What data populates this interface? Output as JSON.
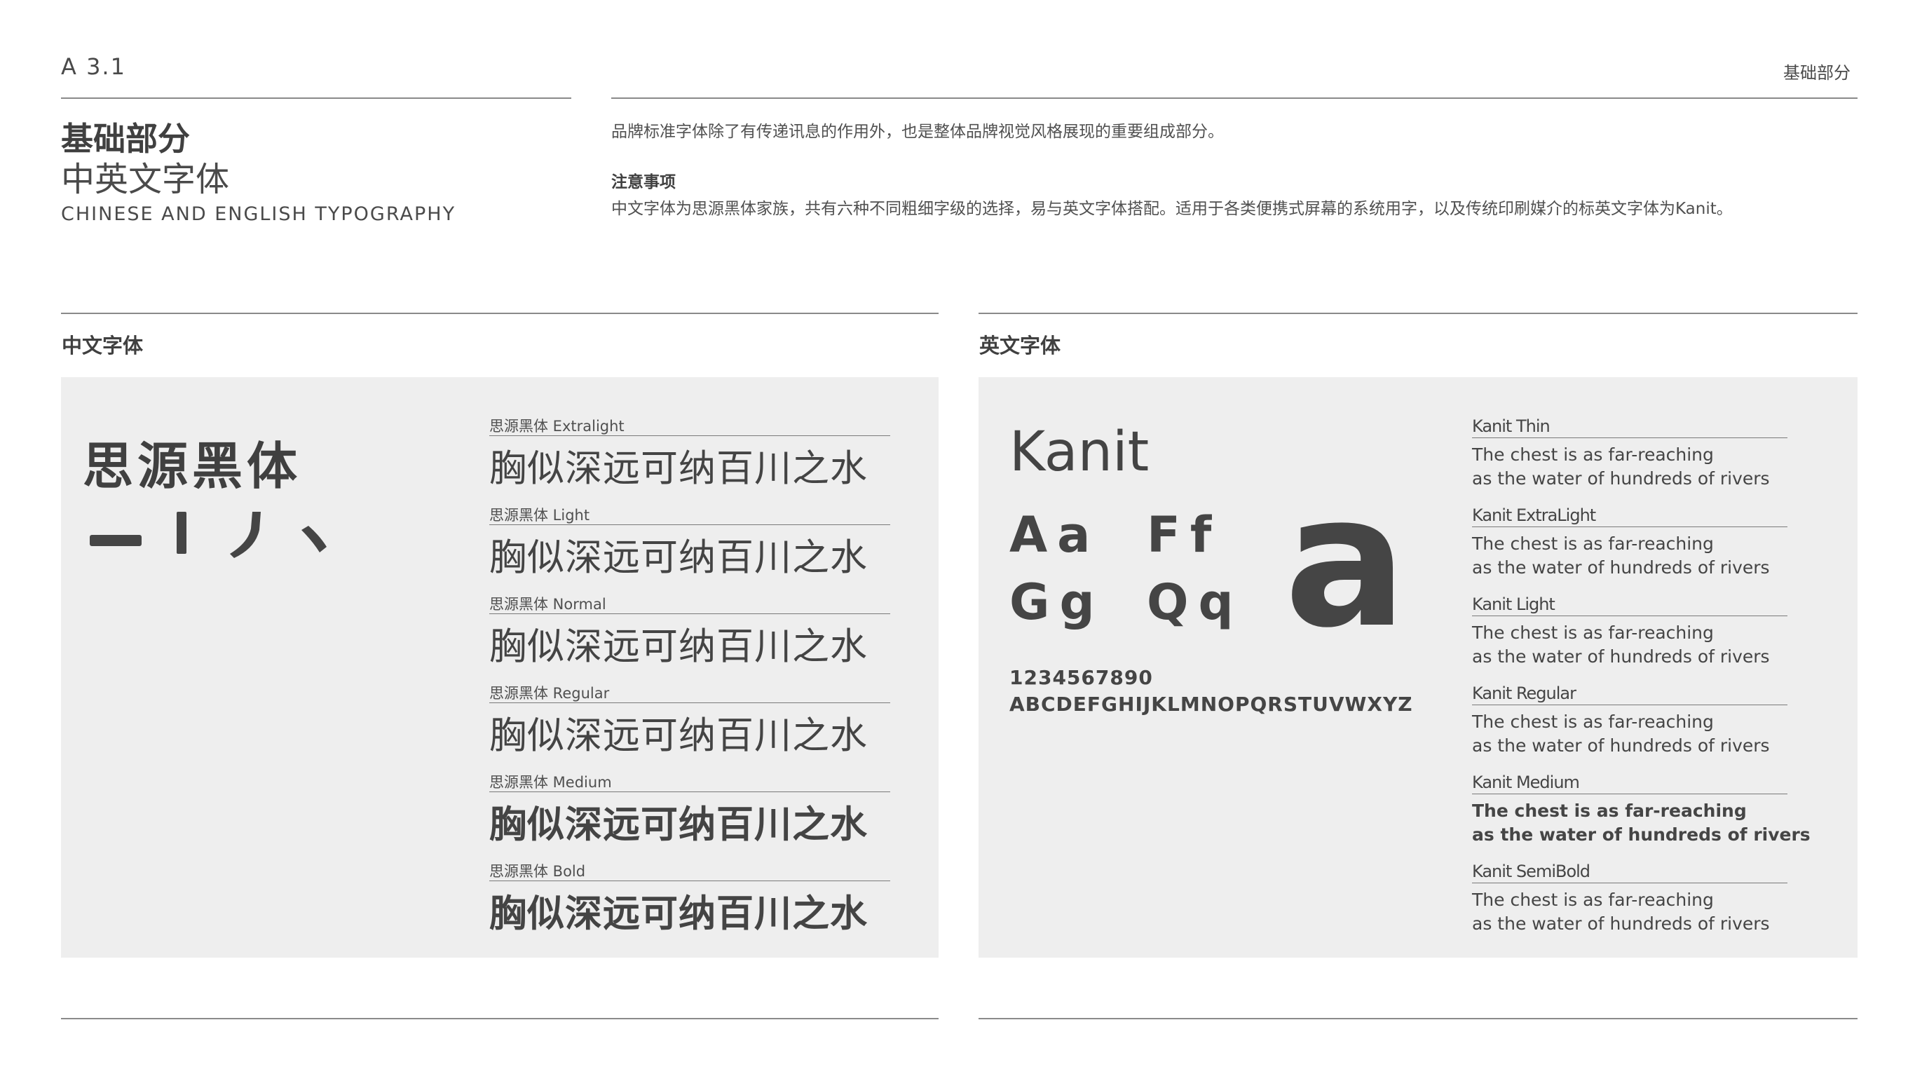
{
  "header": {
    "page_code": "A  3.1",
    "section_right": "基础部分"
  },
  "title": {
    "main": "基础部分",
    "sub": "中英文字体",
    "english": "CHINESE AND ENGLISH TYPOGRAPHY"
  },
  "intro": {
    "text": "品牌标准字体除了有传递讯息的作用外，也是整体品牌视觉风格展现的重要组成部分。",
    "note_title": "注意事项",
    "note_body": "中文字体为思源黑体家族，共有六种不同粗细字级的选择，易与英文字体搭配。适用于各类便携式屏幕的系统用字，以及传统印刷媒介的标英文字体为Kanit。"
  },
  "chinese_section": {
    "label": "中文字体",
    "font_name": "思源黑体",
    "strokes": [
      "一",
      "丨",
      "丿",
      "丶"
    ],
    "weights": [
      {
        "label": "思源黑体 Extralight",
        "sample": "胸似深远可纳百川之水",
        "weight": 200
      },
      {
        "label": "思源黑体 Light",
        "sample": "胸似深远可纳百川之水",
        "weight": 300
      },
      {
        "label": "思源黑体 Normal",
        "sample": "胸似深远可纳百川之水",
        "weight": 400
      },
      {
        "label": "思源黑体 Regular",
        "sample": "胸似深远可纳百川之水",
        "weight": 500
      },
      {
        "label": "思源黑体 Medium",
        "sample": "胸似深远可纳百川之水",
        "weight": 600
      },
      {
        "label": "思源黑体 Bold",
        "sample": "胸似深远可纳百川之水",
        "weight": 700
      }
    ]
  },
  "english_section": {
    "label": "英文字体",
    "font_name": "Kanit",
    "glyph_pairs": [
      "Aa",
      "Ff",
      "Gg",
      "Qq"
    ],
    "big_glyph": "a",
    "digits": "1234567890",
    "alphabet": "ABCDEFGHIJKLMNOPQRSTUVWXYZ",
    "weights": [
      {
        "label": "Kanit Thin",
        "line1": "The chest is as far-reaching",
        "line2": "as the water of hundreds of rivers",
        "weight": 300
      },
      {
        "label": "Kanit ExtraLight",
        "line1": "The chest is as far-reaching",
        "line2": "as the water of hundreds of rivers",
        "weight": 300
      },
      {
        "label": "Kanit Light",
        "line1": "The chest is as far-reaching",
        "line2": "as the water of hundreds of rivers",
        "weight": 400
      },
      {
        "label": "Kanit Regular",
        "line1": "The chest is as far-reaching",
        "line2": "as the water of hundreds of rivers",
        "weight": 400
      },
      {
        "label": "Kanit Medium",
        "line1": "The chest is as far-reaching",
        "line2": "as the water of hundreds of rivers",
        "weight": 700
      },
      {
        "label": "Kanit SemiBold",
        "line1": "The chest is as far-reaching",
        "line2": "as the water of hundreds of rivers",
        "weight": 400
      }
    ]
  },
  "colors": {
    "text": "#4a4a4a",
    "panel": "#eeeeee",
    "rule": "#8a8a8a"
  }
}
